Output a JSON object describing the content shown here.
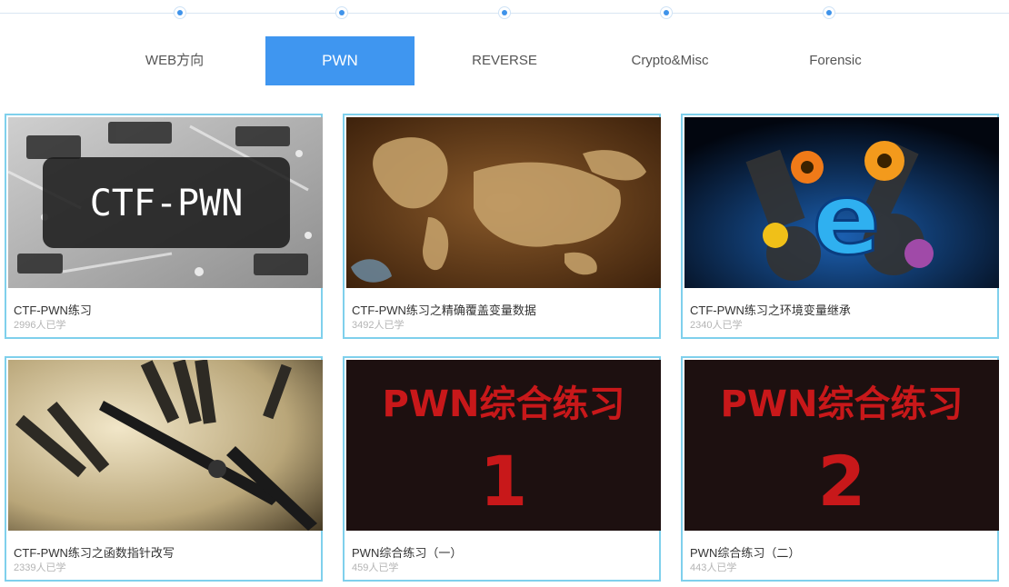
{
  "tabs": [
    {
      "label": "WEB方向",
      "active": false
    },
    {
      "label": "PWN",
      "active": true
    },
    {
      "label": "REVERSE",
      "active": false
    },
    {
      "label": "Crypto&Misc",
      "active": false
    },
    {
      "label": "Forensic",
      "active": false
    }
  ],
  "cards": [
    {
      "title": "CTF-PWN练习",
      "count": "2996人已学",
      "thumb_text": "CTF-PWN"
    },
    {
      "title": "CTF-PWN练习之精确覆盖变量数据",
      "count": "3492人已学"
    },
    {
      "title": "CTF-PWN练习之环境变量继承",
      "count": "2340人已学",
      "thumb_text": "e"
    },
    {
      "title": "CTF-PWN练习之函数指针改写",
      "count": "2339人已学"
    },
    {
      "title": "PWN综合练习（一）",
      "count": "459人已学",
      "thumb_text": "PWN综合练习",
      "thumb_number": "1"
    },
    {
      "title": "PWN综合练习（二）",
      "count": "443人已学",
      "thumb_text": "PWN综合练习",
      "thumb_number": "2"
    }
  ],
  "colors": {
    "accent": "#3f96f0",
    "card_border": "#7fd0ec",
    "timeline_dot": "#3f93ea"
  }
}
